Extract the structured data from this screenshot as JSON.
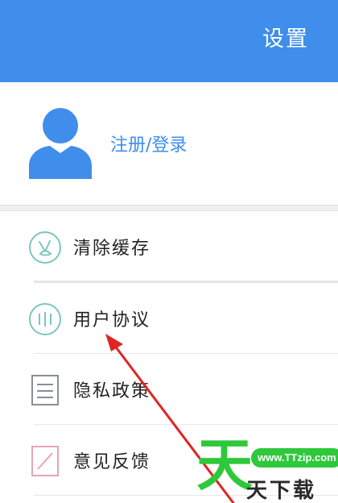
{
  "header": {
    "title": "设置"
  },
  "profile": {
    "login_label": "注册/登录"
  },
  "menu": [
    {
      "label": "清除缓存",
      "icon": "broom-icon"
    },
    {
      "label": "用户协议",
      "icon": "agreement-icon"
    },
    {
      "label": "隐私政策",
      "icon": "document-icon"
    },
    {
      "label": "意见反馈",
      "icon": "edit-icon"
    }
  ],
  "watermark": {
    "logo_char": "天",
    "url": "www.TTzip.com",
    "name": "天下载"
  },
  "colors": {
    "primary": "#3f8eeb",
    "arrow": "#e02424",
    "watermark_green": "#2ec83a"
  }
}
